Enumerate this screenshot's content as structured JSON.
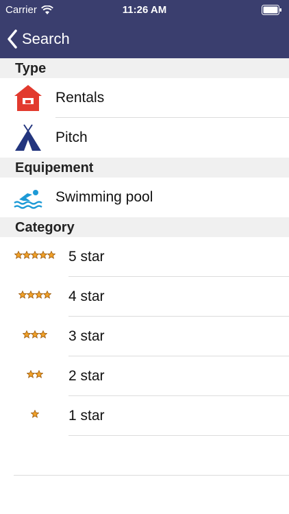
{
  "status_bar": {
    "carrier": "Carrier",
    "time": "11:26 AM"
  },
  "nav": {
    "back_label": "Search"
  },
  "sections": {
    "type": {
      "title": "Type",
      "items": [
        {
          "label": "Rentals",
          "icon": "house-icon"
        },
        {
          "label": "Pitch",
          "icon": "tent-icon"
        }
      ]
    },
    "equipment": {
      "title": "Equipement",
      "items": [
        {
          "label": "Swimming pool",
          "icon": "swimmer-icon"
        }
      ]
    },
    "category": {
      "title": "Category",
      "items": [
        {
          "label": "5 star",
          "stars": 5
        },
        {
          "label": "4 star",
          "stars": 4
        },
        {
          "label": "3 star",
          "stars": 3
        },
        {
          "label": "2 star",
          "stars": 2
        },
        {
          "label": "1 star",
          "stars": 1
        }
      ]
    }
  },
  "colors": {
    "nav_bg": "#3a3e6e",
    "house": "#e23a2e",
    "tent": "#23357e",
    "pool": "#1d9ad6",
    "star": "#f0a028"
  }
}
